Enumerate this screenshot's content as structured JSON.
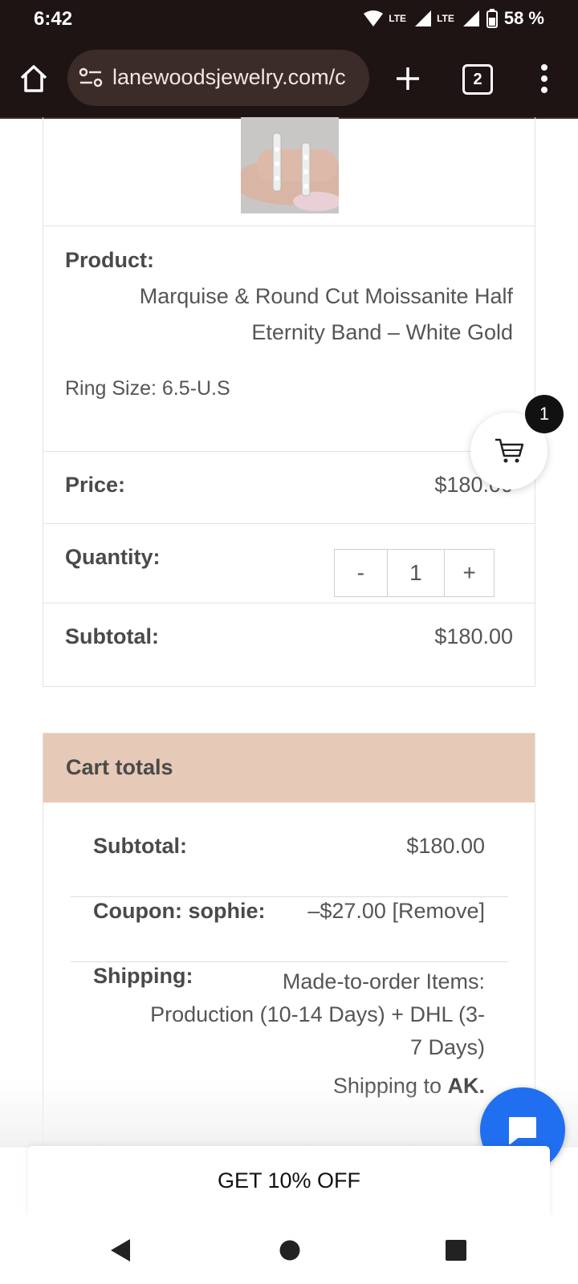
{
  "status_bar": {
    "time": "6:42",
    "network_1": "LTE",
    "network_2": "LTE",
    "battery": "58 %"
  },
  "browser": {
    "url": "lanewoodsjewelry.com/c",
    "tab_count": "2"
  },
  "product_table": {
    "product_label": "Product:",
    "product_name_line1": "Marquise & Round Cut Moissanite Half",
    "product_name_line2": "Eternity Band – White Gold",
    "ring_size": "Ring Size: 6.5-U.S",
    "price_label": "Price:",
    "price_value": "$180.00",
    "quantity_label": "Quantity:",
    "qty_minus": "-",
    "qty_value": "1",
    "qty_plus": "+",
    "subtotal_label": "Subtotal:",
    "subtotal_value": "$180.00"
  },
  "cart_totals": {
    "title": "Cart totals",
    "subtotal_label": "Subtotal:",
    "subtotal_value": "$180.00",
    "coupon_label": "Coupon: sophie:",
    "coupon_value": "–$27.00",
    "coupon_remove": "[Remove]",
    "shipping_label": "Shipping:",
    "shipping_line1": "Made-to-order Items:",
    "shipping_line2": "Production (10-14 Days) + DHL (3-",
    "shipping_line3": "7 Days)",
    "shipping_to": "Shipping to",
    "shipping_to_place": "AK."
  },
  "floating_cart": {
    "count": "1"
  },
  "promo": {
    "label": "GET 10% OFF"
  },
  "colors": {
    "header_bg": "#1e1414",
    "totals_header_bg": "#e6c9b6",
    "chat_button": "#1f6ff0"
  }
}
